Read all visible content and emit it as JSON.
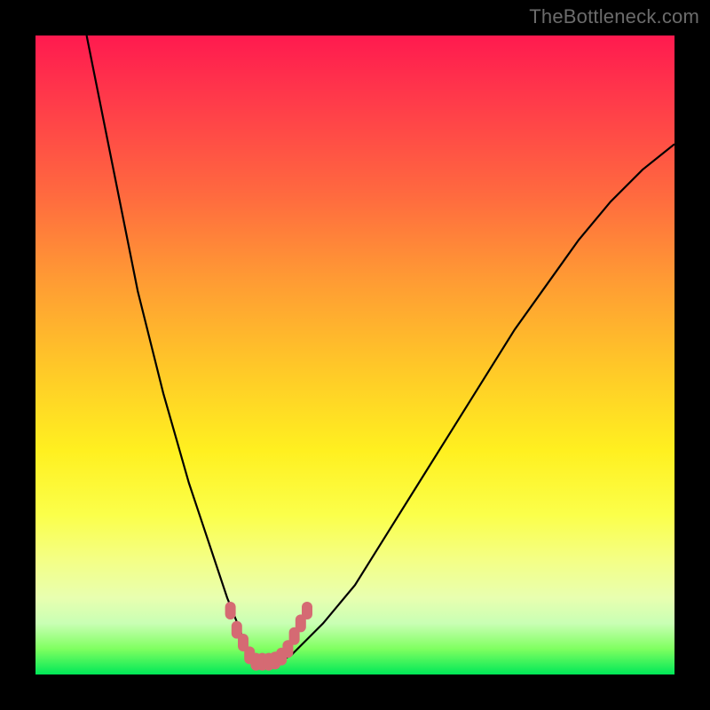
{
  "watermark": {
    "text": "TheBottleneck.com"
  },
  "colors": {
    "curve_stroke": "#000000",
    "marker_fill": "#d56a73",
    "marker_stroke": "#d56a73"
  },
  "chart_data": {
    "type": "line",
    "title": "",
    "xlabel": "",
    "ylabel": "",
    "xlim": [
      0,
      100
    ],
    "ylim": [
      0,
      100
    ],
    "grid": false,
    "legend": false,
    "series": [
      {
        "name": "bottleneck-curve",
        "x": [
          8,
          10,
          12,
          14,
          16,
          18,
          20,
          22,
          24,
          26,
          28,
          30,
          32,
          33,
          35,
          38,
          40,
          42,
          45,
          50,
          55,
          60,
          65,
          70,
          75,
          80,
          85,
          90,
          95,
          100
        ],
        "y": [
          100,
          90,
          80,
          70,
          60,
          52,
          44,
          37,
          30,
          24,
          18,
          12,
          7,
          4,
          2,
          2,
          3,
          5,
          8,
          14,
          22,
          30,
          38,
          46,
          54,
          61,
          68,
          74,
          79,
          83
        ]
      }
    ],
    "markers": {
      "name": "highlighted-segment",
      "x": [
        30.5,
        31.5,
        32.5,
        33.5,
        34.5,
        35.5,
        36.5,
        37.5,
        38.5,
        39.5,
        40.5,
        41.5
      ],
      "y": [
        10,
        7,
        5,
        3,
        2,
        2,
        2,
        2.2,
        2.8,
        4,
        6,
        8
      ]
    }
  }
}
